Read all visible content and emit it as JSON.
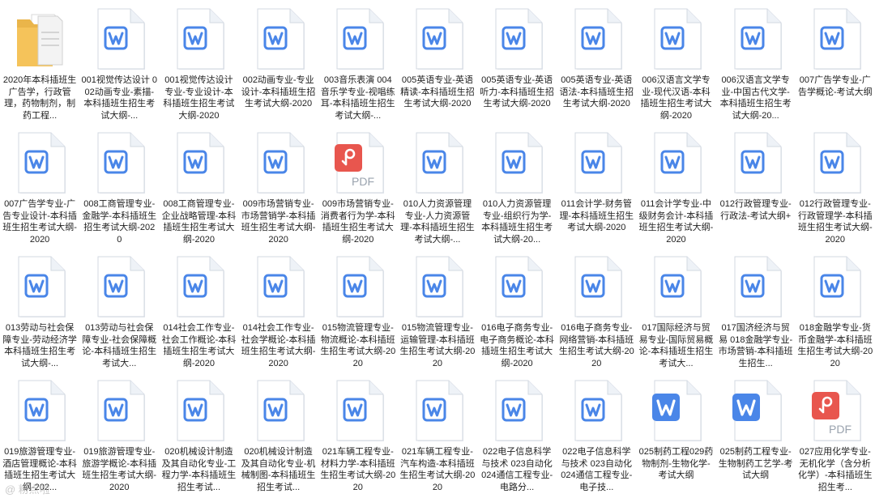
{
  "colors": {
    "word_blue": "#4a86e8",
    "pdf_red": "#e8564e",
    "folder_yellow": "#f5c35a"
  },
  "files": [
    {
      "type": "folder",
      "icon": "folder-icon",
      "label": "2020年本科插班生广告学，行政管理，药物制剂，制药工程..."
    },
    {
      "type": "word",
      "icon": "word-doc-icon",
      "label": "001视觉传达设计 002动画专业-素描-本科插班生招生考试大纲-..."
    },
    {
      "type": "word",
      "icon": "word-doc-icon",
      "label": "001视觉传达设计专业-专业设计-本科插班生招生考试大纲-2020"
    },
    {
      "type": "word",
      "icon": "word-doc-icon",
      "label": "002动画专业-专业设计-本科插班生招生考试大纲-2020"
    },
    {
      "type": "word",
      "icon": "word-doc-icon",
      "label": "003音乐表演 004音乐学专业-视唱练耳-本科插班生招生考试大纲-..."
    },
    {
      "type": "word",
      "icon": "word-doc-icon",
      "label": "005英语专业-英语精读-本科插班生招生考试大纲-2020"
    },
    {
      "type": "word",
      "icon": "word-doc-icon",
      "label": "005英语专业-英语听力-本科插班生招生考试大纲-2020"
    },
    {
      "type": "word",
      "icon": "word-doc-icon",
      "label": "005英语专业-英语语法-本科插班生招生考试大纲-2020"
    },
    {
      "type": "word",
      "icon": "word-doc-icon",
      "label": "006汉语言文学专业-现代汉语-本科插班生招生考试大纲-2020"
    },
    {
      "type": "word",
      "icon": "word-doc-icon",
      "label": "006汉语言文学专业-中国古代文学-本科插班生招生考试大纲-20..."
    },
    {
      "type": "word",
      "icon": "word-doc-icon",
      "label": "007广告学专业-广告学概论-考试大纲"
    },
    {
      "type": "word",
      "icon": "word-doc-icon",
      "label": "007广告学专业-广告专业设计-本科插班生招生考试大纲-2020"
    },
    {
      "type": "word",
      "icon": "word-doc-icon",
      "label": "008工商管理专业-金融学-本科插班生招生考试大纲-2020"
    },
    {
      "type": "word",
      "icon": "word-doc-icon",
      "label": "008工商管理专业-企业战略管理-本科插班生招生考试大纲-2020"
    },
    {
      "type": "word",
      "icon": "word-doc-icon",
      "label": "009市场营销专业-市场营销学-本科插班生招生考试大纲-2020"
    },
    {
      "type": "pdf",
      "icon": "pdf-doc-icon",
      "label": "009市场营销专业-消费者行为学-本科插班生招生考试大纲-2020"
    },
    {
      "type": "word",
      "icon": "word-doc-icon",
      "label": "010人力资源管理专业-人力资源管理-本科插班生招生考试大纲-..."
    },
    {
      "type": "word",
      "icon": "word-doc-icon",
      "label": "010人力资源管理专业-组织行为学-本科插班生招生考试大纲-20..."
    },
    {
      "type": "word",
      "icon": "word-doc-icon",
      "label": "011会计学-财务管理-本科插班生招生考试大纲-2020"
    },
    {
      "type": "word",
      "icon": "word-doc-icon",
      "label": "011会计学专业-中级财务会计-本科插班生招生考试大纲-2020"
    },
    {
      "type": "word",
      "icon": "word-doc-icon",
      "label": "012行政管理专业-行政法-考试大纲+"
    },
    {
      "type": "word",
      "icon": "word-doc-icon",
      "label": "012行政管理专业-行政管理学-本科插班生招生考试大纲-2020"
    },
    {
      "type": "word",
      "icon": "word-doc-icon",
      "label": "013劳动与社会保障专业-劳动经济学本科插班生招生考试大纲-..."
    },
    {
      "type": "word",
      "icon": "word-doc-icon",
      "label": "013劳动与社会保障专业-社会保障概论-本科插班生招生考试大..."
    },
    {
      "type": "word",
      "icon": "word-doc-icon",
      "label": "014社会工作专业-社会工作概论-本科插班生招生考试大纲-2020"
    },
    {
      "type": "word",
      "icon": "word-doc-icon",
      "label": "014社会工作专业-社会学概论-本科插班生招生考试大纲-2020"
    },
    {
      "type": "word",
      "icon": "word-doc-icon",
      "label": "015物流管理专业-物流概论-本科插班生招生考试大纲-2020"
    },
    {
      "type": "word",
      "icon": "word-doc-icon",
      "label": "015物流管理专业-运输管理-本科插班生招生考试大纲-2020"
    },
    {
      "type": "word",
      "icon": "word-doc-icon",
      "label": "016电子商务专业-电子商务概论-本科插班生招生考试大纲-2020"
    },
    {
      "type": "word",
      "icon": "word-doc-icon",
      "label": "016电子商务专业-网络营销-本科插班生招生考试大纲-2020"
    },
    {
      "type": "word",
      "icon": "word-doc-icon",
      "label": "017国际经济与贸易专业-国际贸易概论-本科插班生招生考试大..."
    },
    {
      "type": "word",
      "icon": "word-doc-icon",
      "label": "017国济经济与贸易 018金融学专业-市场营销-本科插班生招生..."
    },
    {
      "type": "word",
      "icon": "word-doc-icon",
      "label": "018金融学专业-货币金融学-本科插班生招生考试大纲-2020"
    },
    {
      "type": "word",
      "icon": "word-doc-icon",
      "label": "019旅游管理专业-酒店管理概论-本科插班生招生考试大纲-202..."
    },
    {
      "type": "word",
      "icon": "word-doc-icon",
      "label": "019旅游管理专业-旅游学概论-本科插班生招生考试大纲-2020"
    },
    {
      "type": "word",
      "icon": "word-doc-icon",
      "label": "020机械设计制造及其自动化专业-工程力学-本科插班生招生考试..."
    },
    {
      "type": "word",
      "icon": "word-doc-icon",
      "label": "020机械设计制造及其自动化专业-机械制图-本科插班生招生考试..."
    },
    {
      "type": "word",
      "icon": "word-doc-icon",
      "label": "021车辆工程专业-材料力学-本科插班生招生考试大纲-2020"
    },
    {
      "type": "word",
      "icon": "word-doc-icon",
      "label": "021车辆工程专业-汽车构造-本科插班生招生考试大纲-2020"
    },
    {
      "type": "word",
      "icon": "word-doc-icon",
      "label": "022电子信息科学与技术 023自动化 024通信工程专业-电路分..."
    },
    {
      "type": "word",
      "icon": "word-doc-icon",
      "label": "022电子信息科学与技术 023自动化 024通信工程专业-电子技..."
    },
    {
      "type": "wordsolid",
      "icon": "word-doc-icon",
      "label": "025制药工程029药物制剂-生物化学-考试大纲"
    },
    {
      "type": "wordsolid",
      "icon": "word-doc-icon",
      "label": "025制药工程专业-生物制药工艺学-考试大纲"
    },
    {
      "type": "pdf",
      "icon": "pdf-doc-icon",
      "label": "027应用化学专业-无机化学（含分析化学）-本科插班生招生考..."
    }
  ],
  "watermark": "@ 粉点啦"
}
